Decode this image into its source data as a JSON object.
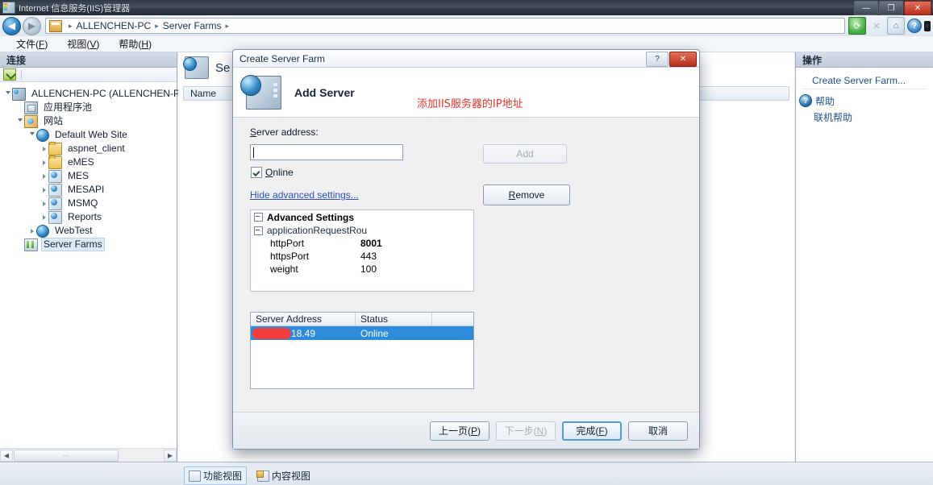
{
  "window": {
    "title": "Internet 信息服务(IIS)管理器",
    "icon": "iis-manager-icon",
    "buttons": {
      "minimize": "—",
      "restore": "❐",
      "close": "✕"
    }
  },
  "addressbar": {
    "back": "◀",
    "forward": "▶",
    "crumb_icon": "server-icon",
    "crumbs": [
      "ALLENCHEN-PC",
      "Server Farms"
    ],
    "separator": "▸",
    "trailing_separator": "▸",
    "icons": [
      {
        "name": "refresh-icon",
        "glyph": "⟳"
      },
      {
        "name": "stop-icon",
        "glyph": "✕"
      },
      {
        "name": "home-icon",
        "glyph": "⌂"
      },
      {
        "name": "help-icon",
        "glyph": "?"
      },
      {
        "name": "help-dropdown-caret",
        "glyph": "▼"
      }
    ]
  },
  "menubar": {
    "items": [
      {
        "label": "文件",
        "accel": "F"
      },
      {
        "label": "视图",
        "accel": "V"
      },
      {
        "label": "帮助",
        "accel": "H"
      }
    ]
  },
  "connections_pane": {
    "header": "连接",
    "toolbar_icon": "connect-to-server-icon",
    "tree": [
      {
        "label": "ALLENCHEN-PC (ALLENCHEN-PC\\Ad",
        "icon": "server-icon",
        "indent": 0,
        "expander": "open"
      },
      {
        "label": "应用程序池",
        "icon": "app-pools-icon",
        "indent": 1,
        "expander": "none"
      },
      {
        "label": "网站",
        "icon": "sites-icon",
        "indent": 1,
        "expander": "open"
      },
      {
        "label": "Default Web Site",
        "icon": "website-globe-icon",
        "indent": 2,
        "expander": "open"
      },
      {
        "label": "aspnet_client",
        "icon": "folder-icon",
        "indent": 3,
        "expander": "closed"
      },
      {
        "label": "eMES",
        "icon": "folder-icon",
        "indent": 3,
        "expander": "closed"
      },
      {
        "label": "MES",
        "icon": "application-icon",
        "indent": 3,
        "expander": "closed"
      },
      {
        "label": "MESAPI",
        "icon": "application-icon",
        "indent": 3,
        "expander": "closed"
      },
      {
        "label": "MSMQ",
        "icon": "application-icon",
        "indent": 3,
        "expander": "closed"
      },
      {
        "label": "Reports",
        "icon": "application-icon",
        "indent": 3,
        "expander": "closed"
      },
      {
        "label": "WebTest",
        "icon": "website-globe-icon",
        "indent": 2,
        "expander": "closed"
      },
      {
        "label": "Server Farms",
        "icon": "server-farms-icon",
        "indent": 1,
        "expander": "none",
        "selected": true
      }
    ],
    "scrollbar": {
      "left_arrow": "◀",
      "right_arrow": "▶",
      "thumb_grip": "⋯"
    }
  },
  "content_pane": {
    "icon": "server-farms-icon",
    "title": "Se",
    "columns": [
      "Name"
    ]
  },
  "actions_pane": {
    "header": "操作",
    "primary_link": "Create Server Farm...",
    "help_icon": "help-icon",
    "links": [
      "帮助",
      "联机帮助"
    ]
  },
  "statusbar": {
    "tabs": [
      {
        "label": "功能视图",
        "icon": "features-view-icon",
        "active": true
      },
      {
        "label": "内容视图",
        "icon": "content-view-icon",
        "active": false
      }
    ]
  },
  "dialog": {
    "title": "Create Server Farm",
    "titlebar_buttons": {
      "help": "?",
      "close": "✕"
    },
    "banner": {
      "icon": "add-server-icon",
      "heading": "Add Server",
      "annotation": "添加IIS服务器的IP地址",
      "annotation_color": "#e8332a"
    },
    "server_address": {
      "label": "Server address:",
      "accel": "S",
      "value": "",
      "placeholder": ""
    },
    "online_checkbox": {
      "label": "Online",
      "accel": "O",
      "checked": true
    },
    "advanced_link": {
      "label": "Hide advanced settings...",
      "accel": ""
    },
    "add_button": {
      "label": "Add",
      "accel": "A",
      "enabled": false
    },
    "remove_button": {
      "label": "Remove",
      "accel": "R",
      "enabled": true
    },
    "advanced_settings": {
      "root_label": "Advanced Settings",
      "group_label": "applicationRequestRou",
      "rows": [
        {
          "key": "httpPort",
          "value": "8001",
          "modified": true
        },
        {
          "key": "httpsPort",
          "value": "443",
          "modified": false
        },
        {
          "key": "weight",
          "value": "100",
          "modified": false
        }
      ]
    },
    "servers_grid": {
      "columns": [
        "Server Address",
        "Status"
      ],
      "rows": [
        {
          "address": "18.49",
          "address_redacted": true,
          "status": "Online",
          "selected": true
        }
      ]
    },
    "footer_buttons": [
      {
        "label": "上一页",
        "accel": "P",
        "state": "enabled",
        "name": "previous-button"
      },
      {
        "label": "下一步",
        "accel": "N",
        "state": "disabled",
        "name": "next-button"
      },
      {
        "label": "完成",
        "accel": "F",
        "state": "default",
        "name": "finish-button"
      },
      {
        "label": "取消",
        "accel": "",
        "state": "enabled",
        "name": "cancel-button"
      }
    ]
  }
}
